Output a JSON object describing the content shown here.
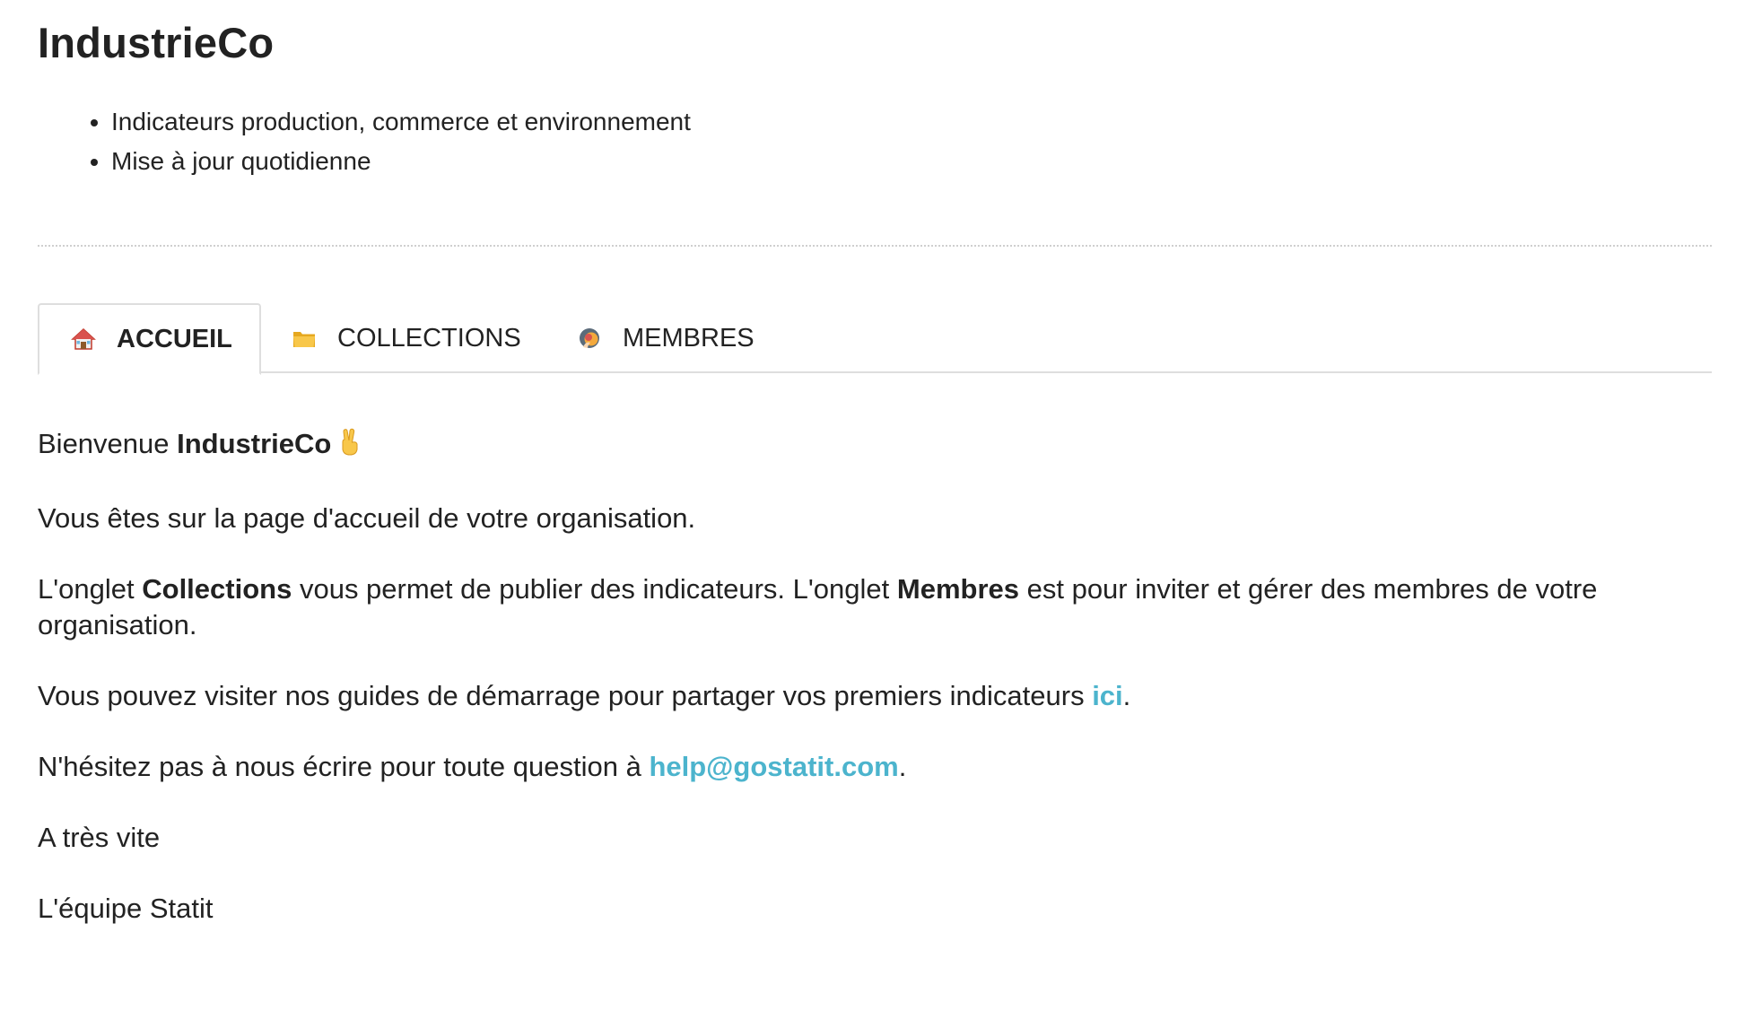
{
  "org": {
    "name": "IndustrieCo",
    "bullets": [
      "Indicateurs production, commerce et environnement",
      "Mise à jour quotidienne"
    ]
  },
  "tabs": [
    {
      "label": "ACCUEIL",
      "icon": "house-icon",
      "active": true
    },
    {
      "label": "COLLECTIONS",
      "icon": "folder-icon",
      "active": false
    },
    {
      "label": "MEMBRES",
      "icon": "people-icon",
      "active": false
    }
  ],
  "welcome": {
    "greeting_prefix": "Bienvenue ",
    "greeting_name": "IndustrieCo",
    "intro": "Vous êtes sur la page d'accueil de votre organisation.",
    "tabs_text_1": "L'onglet ",
    "tabs_strong_1": "Collections",
    "tabs_text_2": " vous permet de publier des indicateurs. L'onglet ",
    "tabs_strong_2": "Membres",
    "tabs_text_3": " est pour inviter et gérer des membres de votre organisation.",
    "guides_text": "Vous pouvez visiter nos guides de démarrage pour partager vos premiers indicateurs ",
    "guides_link": "ici",
    "guides_end": ".",
    "contact_text": "N'hésitez pas à nous écrire pour toute question à ",
    "contact_email": "help@gostatit.com",
    "contact_end": ".",
    "signoff": "A très vite",
    "signature": "L'équipe Statit"
  },
  "colors": {
    "link": "#4cb4cd",
    "text": "#222222",
    "border": "#dedede"
  }
}
